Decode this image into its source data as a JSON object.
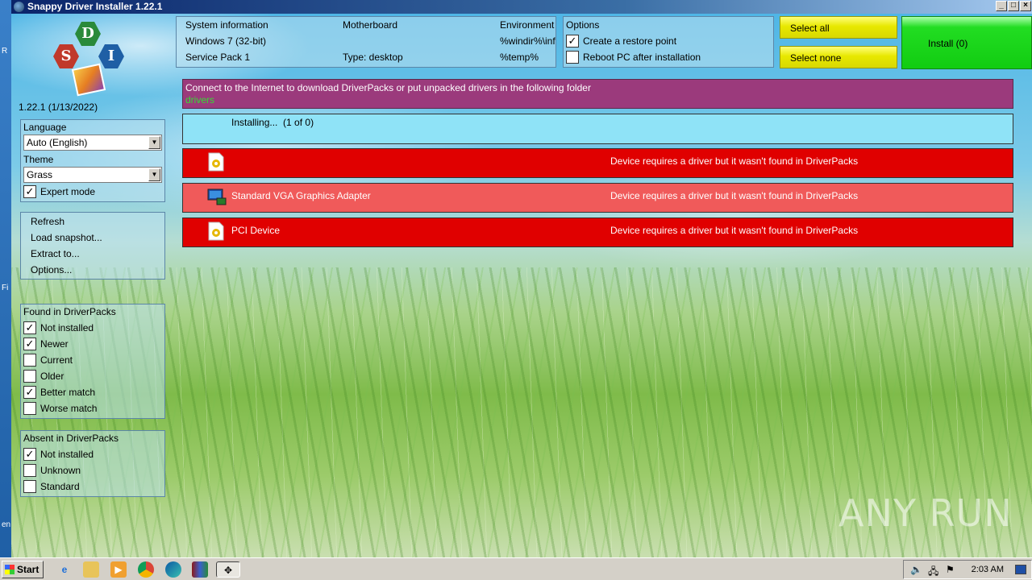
{
  "window": {
    "title": "Snappy Driver Installer 1.22.1"
  },
  "logo": {
    "letters": [
      "D",
      "S",
      "I"
    ]
  },
  "version": "1.22.1 (1/13/2022)",
  "settings": {
    "language_label": "Language",
    "language_value": "Auto (English)",
    "theme_label": "Theme",
    "theme_value": "Grass",
    "expert_mode": {
      "label": "Expert mode",
      "checked": true
    }
  },
  "actions": [
    "Refresh",
    "Load snapshot...",
    "Extract to...",
    "Options..."
  ],
  "found_filters": {
    "title": "Found in DriverPacks",
    "items": [
      {
        "label": "Not installed",
        "checked": true
      },
      {
        "label": "Newer",
        "checked": true
      },
      {
        "label": "Current",
        "checked": false
      },
      {
        "label": "Older",
        "checked": false
      },
      {
        "label": "Better match",
        "checked": true
      },
      {
        "label": "Worse match",
        "checked": false
      }
    ]
  },
  "absent_filters": {
    "title": "Absent in DriverPacks",
    "items": [
      {
        "label": "Not installed",
        "checked": true
      },
      {
        "label": "Unknown",
        "checked": false
      },
      {
        "label": "Standard",
        "checked": false
      }
    ]
  },
  "sysinfo": {
    "col1": [
      "System information",
      "Windows 7 (32-bit)",
      "Service Pack 1"
    ],
    "col2": [
      "Motherboard",
      "",
      "Type: desktop"
    ],
    "col3": [
      "Environment",
      "%windir%\\inf",
      "%temp%"
    ]
  },
  "options": {
    "title": "Options",
    "create_restore": {
      "label": "Create a restore point",
      "checked": true
    },
    "reboot": {
      "label": "Reboot PC after installation",
      "checked": false
    }
  },
  "buttons": {
    "select_all": "Select all",
    "select_none": "Select none",
    "install": "Install (0)"
  },
  "message": {
    "line1": "Connect to the Internet to download DriverPacks or put unpacked drivers in the following folder",
    "folder": "drivers"
  },
  "installing": {
    "label": "Installing...",
    "progress": "(1 of 0)"
  },
  "devices": [
    {
      "name": "",
      "status": "Device requires a driver but it wasn't found in DriverPacks",
      "icon": "unknown-device-icon",
      "style": "red"
    },
    {
      "name": "Standard VGA Graphics Adapter",
      "status": "Device requires a driver but it wasn't found in DriverPacks",
      "icon": "display-adapter-icon",
      "style": "pink"
    },
    {
      "name": "PCI Device",
      "status": "Device requires a driver but it wasn't found in DriverPacks",
      "icon": "unknown-device-icon",
      "style": "red"
    }
  ],
  "watermark": "ANY RUN",
  "taskbar": {
    "start_label": "Start",
    "clock": "2:03 AM",
    "apps": [
      "internet-explorer-icon",
      "file-explorer-icon",
      "media-player-icon",
      "chrome-icon",
      "edge-icon",
      "winrar-icon",
      "snappy-driver-installer-icon"
    ]
  },
  "colors": {
    "message_bg": "#9b3a7c",
    "folder_text": "#33dd33",
    "installing_bg": "#8fe3f7",
    "device_red": "#e00000",
    "device_pink": "#f05a5a",
    "select_buttons": "#e8e800",
    "install_button": "#11cc11"
  }
}
